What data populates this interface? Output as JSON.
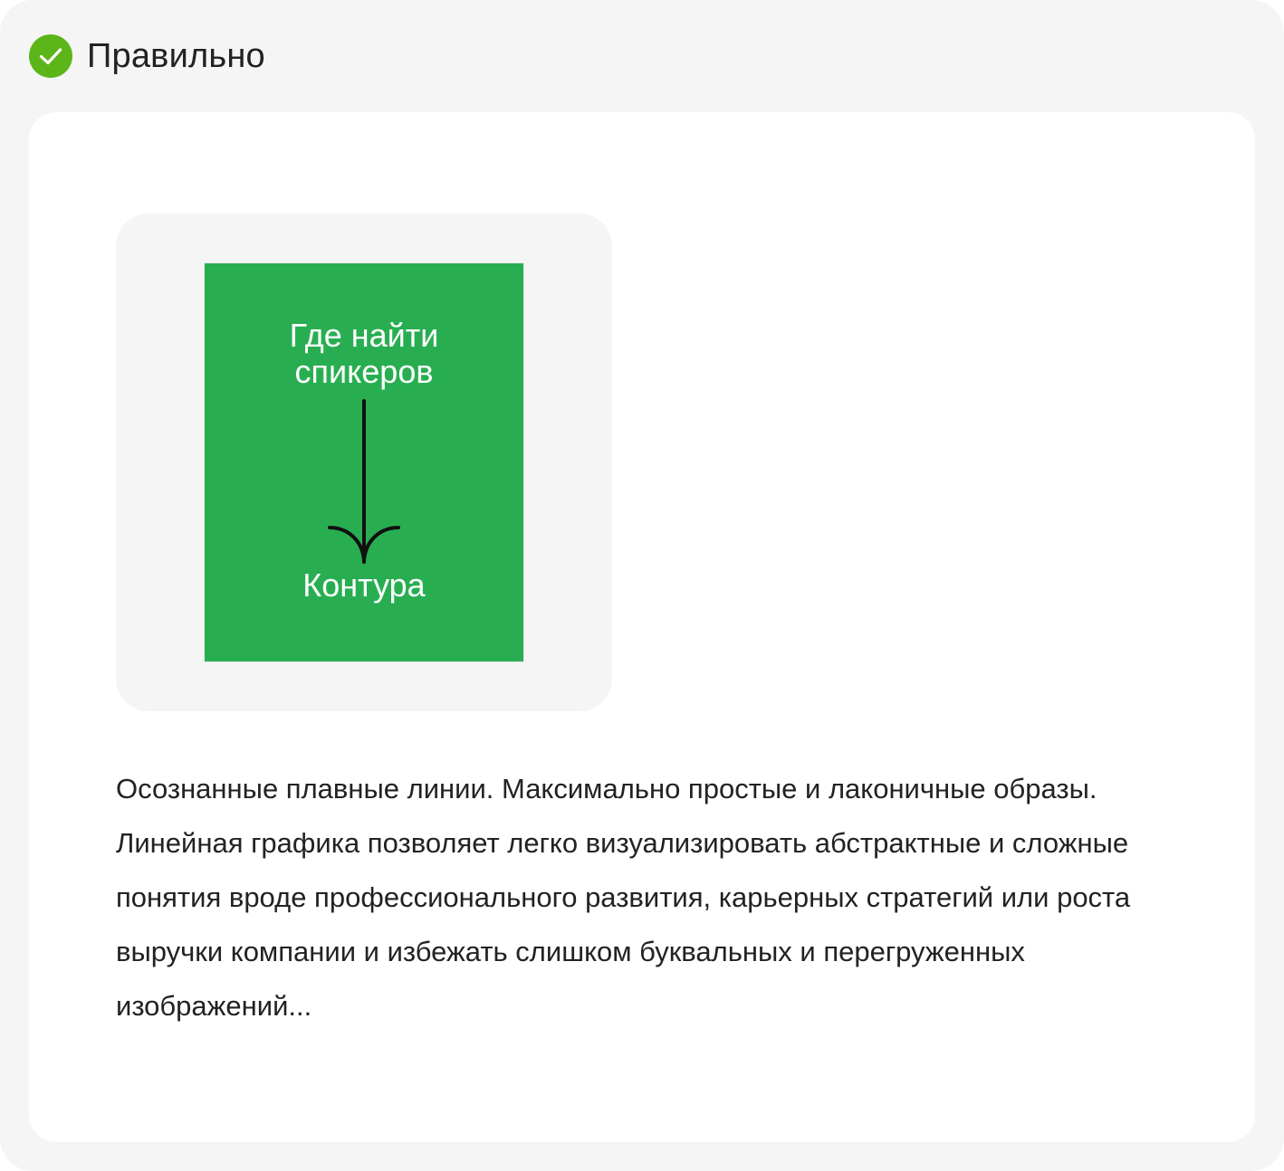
{
  "header": {
    "title": "Правильно",
    "icon": "check-circle-icon",
    "icon_color": "#5cb519"
  },
  "preview": {
    "cover_title": "Где найти\nспикеров",
    "cover_footer": "Контура",
    "cover_color": "#28ae51",
    "arrow_icon": "arrow-down-icon"
  },
  "description": "Осознанные плавные линии. Максимально простые и лаконичные образы. Линейная графика позволяет легко визуализировать абстрактные и сложные понятия вроде профессионального развития, карьерных стратегий или роста выручки компании и избежать слишком буквальных и перегруженных изображений..."
}
